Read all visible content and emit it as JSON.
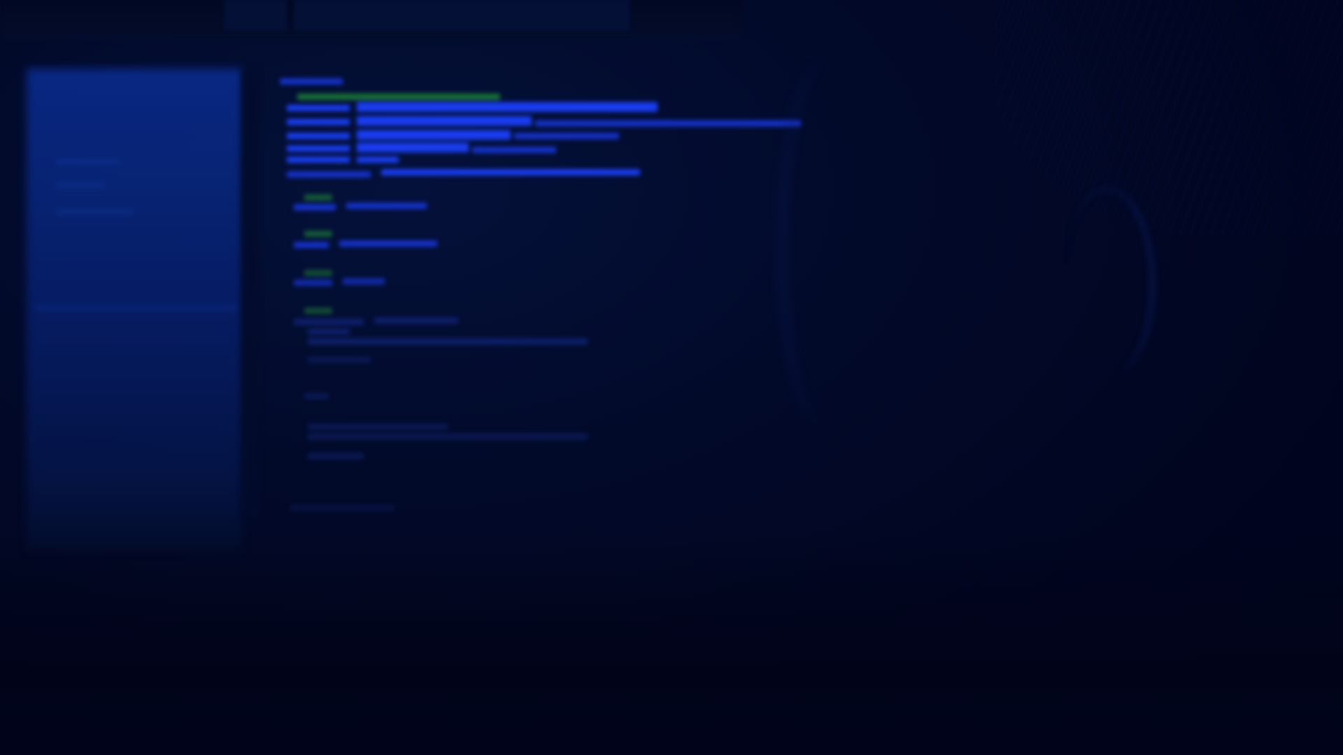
{
  "scene": {
    "description_type": "photo",
    "colors": {
      "background": "#01051a",
      "screen_glow": "#0a2a8a",
      "code_blue": "#1a3df0",
      "code_green": "#1f8a38"
    }
  }
}
